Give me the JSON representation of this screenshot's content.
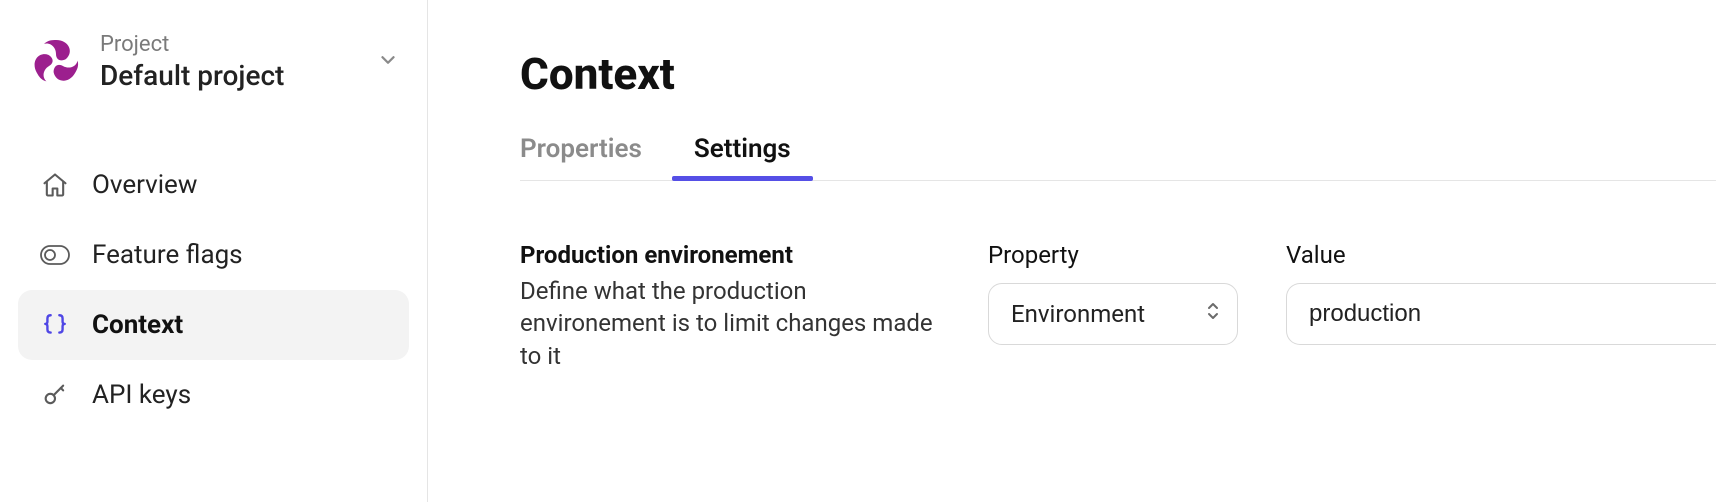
{
  "sidebar": {
    "project": {
      "eyebrow": "Project",
      "name": "Default project"
    },
    "items": [
      {
        "label": "Overview"
      },
      {
        "label": "Feature flags"
      },
      {
        "label": "Context"
      },
      {
        "label": "API keys"
      }
    ]
  },
  "main": {
    "title": "Context",
    "tabs": [
      {
        "label": "Properties"
      },
      {
        "label": "Settings"
      }
    ],
    "setting": {
      "title": "Production environement",
      "description": "Define what the production environement is to limit changes made to it",
      "property": {
        "label": "Property",
        "value": "Environment"
      },
      "value": {
        "label": "Value",
        "value": "production"
      }
    }
  }
}
